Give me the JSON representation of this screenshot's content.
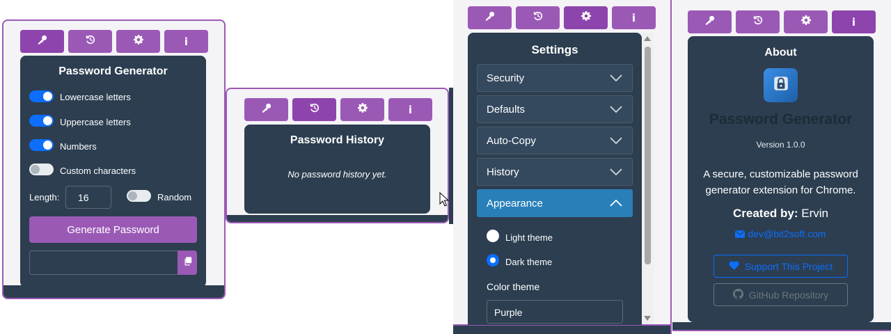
{
  "colors": {
    "accent": "#9b59b6",
    "accent_active": "#8e44ad",
    "panel": "#2c3e50",
    "toggle_on": "#0d6efd",
    "link": "#0d6efd",
    "accordion_open": "#2980b9"
  },
  "tabs": [
    {
      "icon": "key-icon"
    },
    {
      "icon": "history-icon"
    },
    {
      "icon": "gear-icon"
    },
    {
      "icon": "info-icon",
      "glyph": "i"
    }
  ],
  "generator": {
    "title": "Password Generator",
    "options": [
      {
        "label": "Lowercase letters",
        "enabled": true
      },
      {
        "label": "Uppercase letters",
        "enabled": true
      },
      {
        "label": "Numbers",
        "enabled": true
      },
      {
        "label": "Custom characters",
        "enabled": false
      }
    ],
    "length_label": "Length:",
    "length_value": "16",
    "random_label": "Random",
    "random_enabled": false,
    "generate_label": "Generate Password",
    "output_value": ""
  },
  "history": {
    "title": "Password History",
    "empty_text": "No password history yet."
  },
  "settings": {
    "title": "Settings",
    "sections": [
      {
        "label": "Security",
        "open": false
      },
      {
        "label": "Defaults",
        "open": false
      },
      {
        "label": "Auto-Copy",
        "open": false
      },
      {
        "label": "History",
        "open": false
      },
      {
        "label": "Appearance",
        "open": true
      }
    ],
    "theme_options": [
      {
        "label": "Light theme",
        "checked": false
      },
      {
        "label": "Dark theme",
        "checked": true
      }
    ],
    "color_theme_label": "Color theme",
    "color_theme_value": "Purple"
  },
  "about": {
    "title": "About",
    "app_name": "Password Generator",
    "version": "Version 1.0.0",
    "description_line1": "A secure, customizable password",
    "description_line2": "generator extension for Chrome.",
    "created_by_label": "Created by:",
    "created_by_name": "Ervin",
    "email": "dev@bit2soft.com",
    "support_label": "Support This Project",
    "github_label": "GitHub Repository"
  }
}
